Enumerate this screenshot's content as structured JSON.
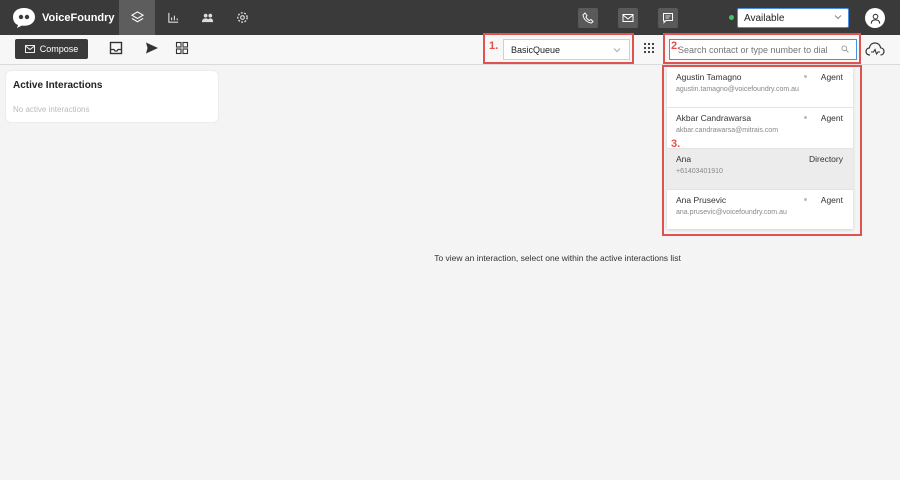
{
  "app": {
    "name": "VoiceFoundry"
  },
  "nav": {
    "tabs": [
      {
        "name": "layers-icon"
      },
      {
        "name": "bar-chart-icon"
      },
      {
        "name": "users-icon"
      },
      {
        "name": "settings-icon"
      }
    ],
    "actions": [
      "phone-icon",
      "mail-icon",
      "chat-icon"
    ]
  },
  "status": {
    "value": "Available",
    "dot_color": "#43c463"
  },
  "toolbar": {
    "compose_label": "Compose",
    "queue_value": "BasicQueue",
    "search_placeholder": "Search contact or type number to dial"
  },
  "annotations": [
    "1.",
    "2.",
    "3."
  ],
  "panel": {
    "title": "Active Interactions",
    "empty": "No active interactions"
  },
  "main": {
    "message": "To view an interaction, select one within the active interactions list"
  },
  "contacts": [
    {
      "name": "Agustin Tamagno",
      "sub": "agustin.tamagno@voicefoundry.com.au",
      "type": "Agent"
    },
    {
      "name": "Akbar Candrawarsa",
      "sub": "akbar.candrawarsa@mitrais.com",
      "type": "Agent"
    },
    {
      "name": "Ana",
      "sub": "+61403401910",
      "type": "Directory"
    },
    {
      "name": "Ana Prusevic",
      "sub": "ana.prusevic@voicefoundry.com.au",
      "type": "Agent"
    }
  ]
}
